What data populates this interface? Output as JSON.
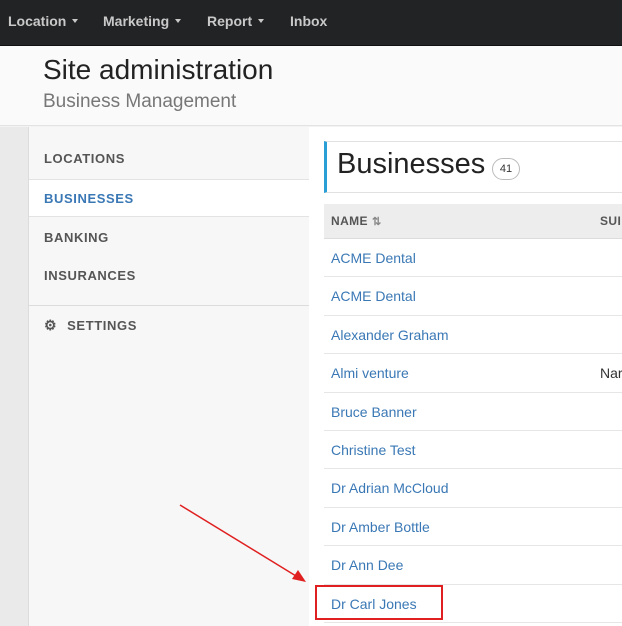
{
  "topnav": {
    "items": [
      {
        "label": "Location",
        "dropdown": true
      },
      {
        "label": "Marketing",
        "dropdown": true
      },
      {
        "label": "Report",
        "dropdown": true
      },
      {
        "label": "Inbox",
        "dropdown": false
      }
    ]
  },
  "header": {
    "title": "Site administration",
    "subtitle": "Business Management"
  },
  "sidebar": {
    "items": [
      {
        "label": "LOCATIONS",
        "active": false
      },
      {
        "label": "BUSINESSES",
        "active": true
      },
      {
        "label": "BANKING",
        "active": false
      },
      {
        "label": "INSURANCES",
        "active": false
      }
    ],
    "settings": {
      "label": "SETTINGS",
      "icon": "gear-icon"
    }
  },
  "main": {
    "title": "Businesses",
    "count": "41",
    "table": {
      "columns": [
        {
          "label": "NAME",
          "sort_icon": "sort-ascending-icon"
        },
        {
          "label": "SUI"
        }
      ],
      "rows": [
        {
          "name": "ACME Dental",
          "sub": ""
        },
        {
          "name": "ACME Dental",
          "sub": ""
        },
        {
          "name": "Alexander Graham",
          "sub": ""
        },
        {
          "name": "Almi venture",
          "sub": "Nar"
        },
        {
          "name": "Bruce Banner",
          "sub": ""
        },
        {
          "name": "Christine Test",
          "sub": ""
        },
        {
          "name": "Dr Adrian McCloud",
          "sub": ""
        },
        {
          "name": "Dr Amber Bottle",
          "sub": ""
        },
        {
          "name": "Dr Ann Dee",
          "sub": ""
        },
        {
          "name": "Dr Carl Jones",
          "sub": ""
        }
      ]
    }
  },
  "colors": {
    "nav_bg": "#222325",
    "link": "#3a78b5",
    "accent": "#2a9fd6",
    "annotation": "#e02020"
  }
}
